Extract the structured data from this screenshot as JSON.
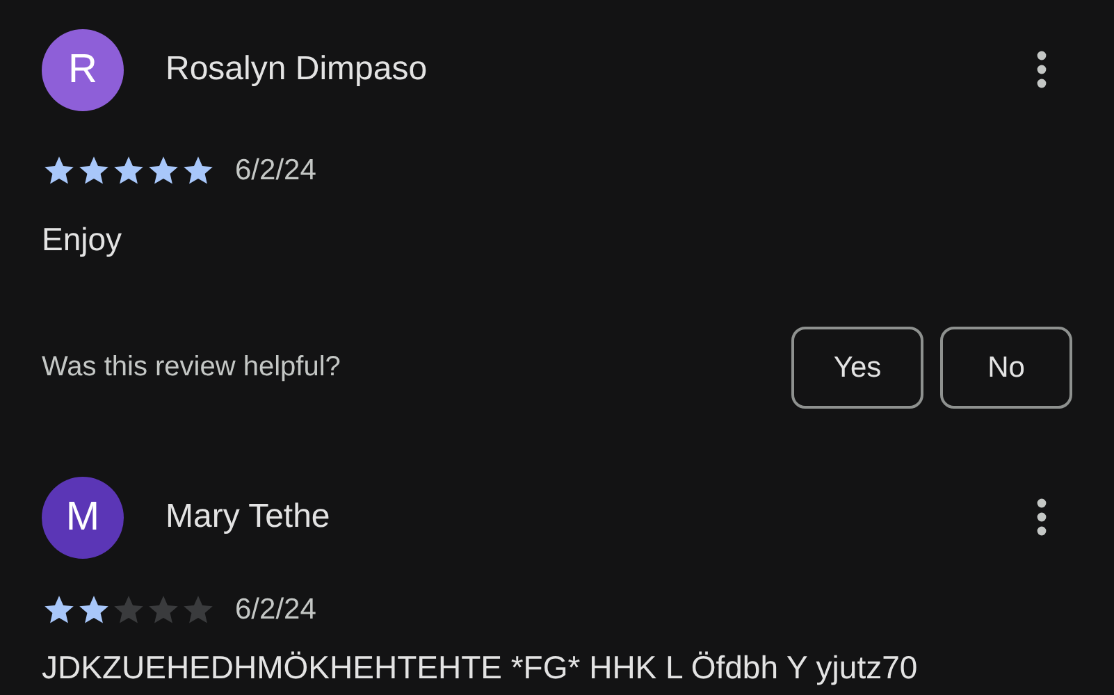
{
  "reviews": [
    {
      "initial": "R",
      "color": "#8e5fd8",
      "name": "Rosalyn Dimpaso",
      "stars": 5,
      "date": "6/2/24",
      "text": "Enjoy",
      "helpful": {
        "question": "Was this review helpful?",
        "buttons": [
          "Yes",
          "No"
        ]
      }
    },
    {
      "initial": "M",
      "color": "#5b36b6",
      "name": "Mary Tethe",
      "stars": 2,
      "date": "6/2/24",
      "text": "JDKZUEHEDHMÖKHEHTEHTE *FG* HHK L Öfdbh Y yjutz70"
    }
  ]
}
